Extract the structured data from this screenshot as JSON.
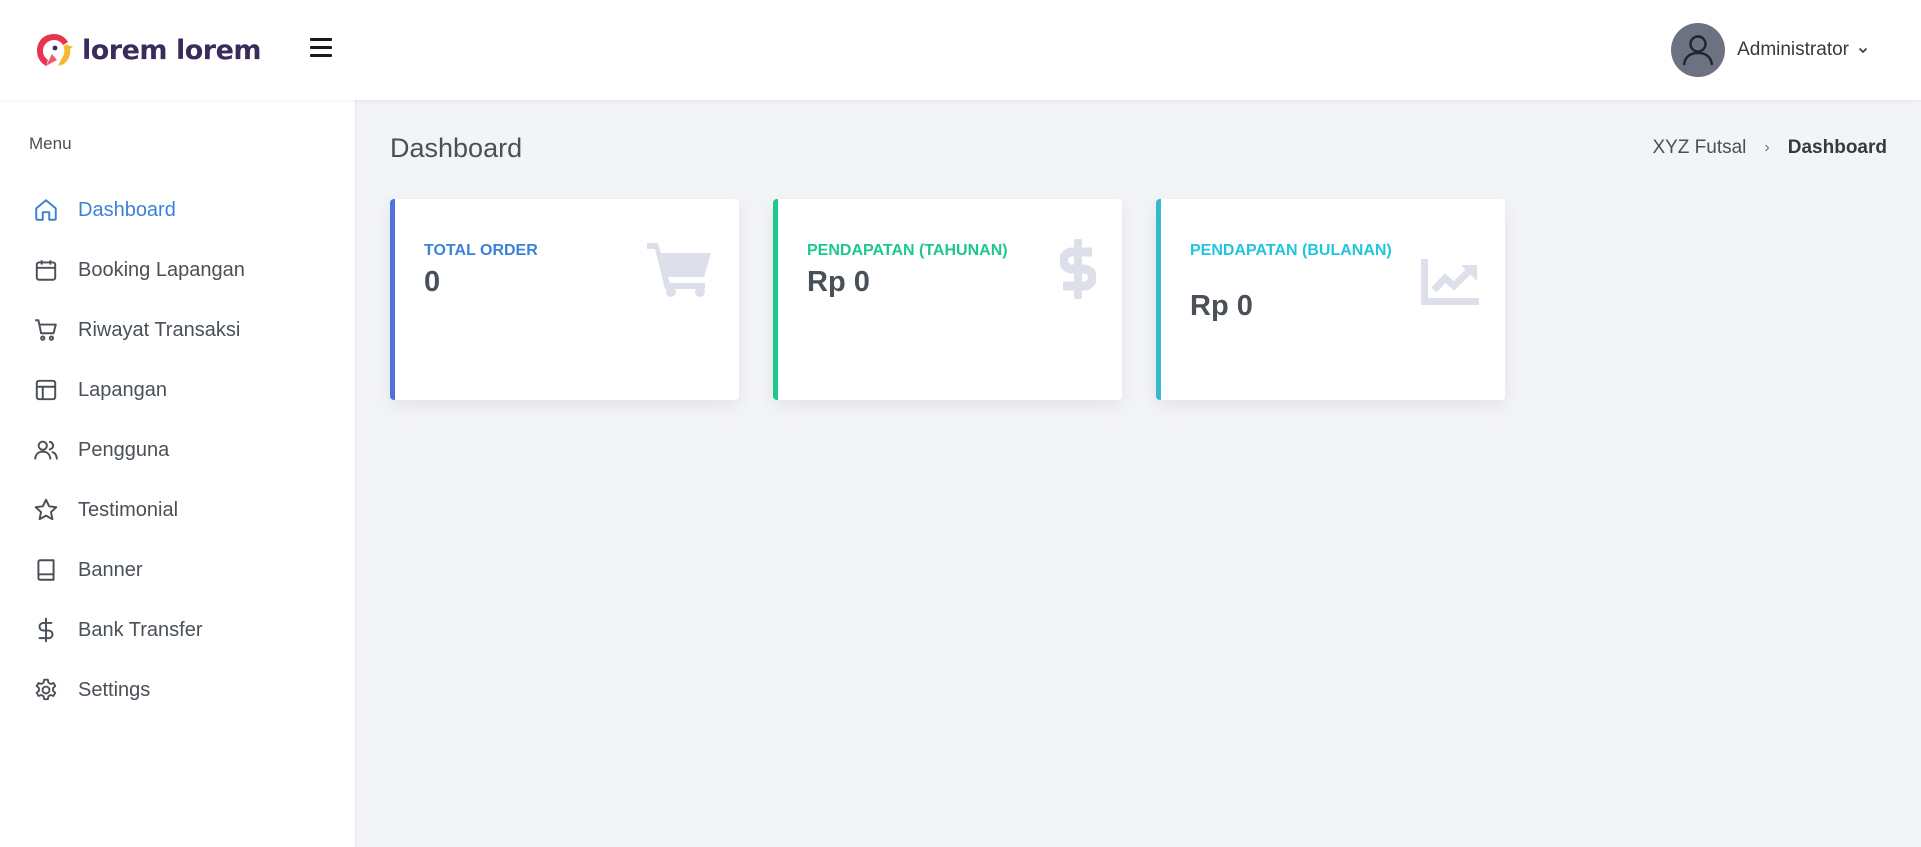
{
  "header": {
    "brand_name": "lorem lorem",
    "user_name": "Administrator"
  },
  "sidebar": {
    "menu_title": "Menu",
    "items": [
      {
        "label": "Dashboard",
        "icon": "home-icon",
        "active": true
      },
      {
        "label": "Booking Lapangan",
        "icon": "calendar-icon"
      },
      {
        "label": "Riwayat Transaksi",
        "icon": "cart-icon"
      },
      {
        "label": "Lapangan",
        "icon": "layout-icon"
      },
      {
        "label": "Pengguna",
        "icon": "users-icon"
      },
      {
        "label": "Testimonial",
        "icon": "star-icon"
      },
      {
        "label": "Banner",
        "icon": "book-icon"
      },
      {
        "label": "Bank Transfer",
        "icon": "dollar-icon"
      },
      {
        "label": "Settings",
        "icon": "gear-icon"
      }
    ]
  },
  "page": {
    "title": "Dashboard",
    "breadcrumb": {
      "parent": "XYZ Futsal",
      "current": "Dashboard"
    }
  },
  "cards": [
    {
      "label": "TOTAL ORDER",
      "value": "0",
      "icon": "shopping-cart-icon",
      "accent": "#4e73df"
    },
    {
      "label": "PENDAPATAN (TAHUNAN)",
      "value": "Rp 0",
      "icon": "dollar-sign-icon",
      "accent": "#1cc88a"
    },
    {
      "label": "PENDAPATAN (BULANAN)",
      "value": "Rp 0",
      "icon": "chart-line-icon",
      "accent": "#36b9cc"
    }
  ],
  "colors": {
    "primary": "#3b82d6",
    "background": "#f3f4f7",
    "icon_muted": "#dddfeb"
  }
}
